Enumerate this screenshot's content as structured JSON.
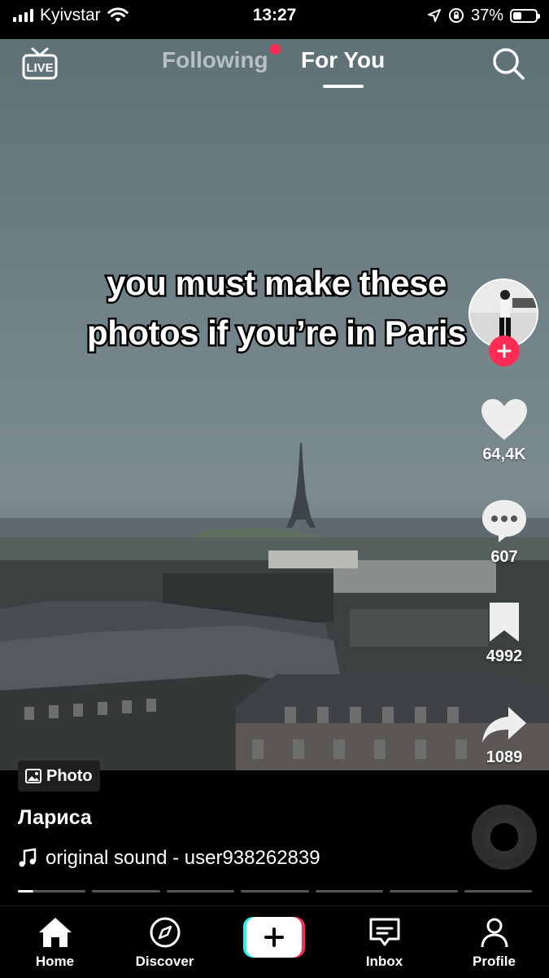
{
  "status_bar": {
    "carrier": "Kyivstar",
    "time": "13:27",
    "battery": "37%",
    "battery_level": 0.37
  },
  "top_nav": {
    "live_label": "LIVE",
    "following_label": "Following",
    "for_you_label": "For You"
  },
  "post": {
    "caption_line1": "you must make these",
    "caption_line2": "photos if you’re in Paris",
    "likes": "64,4K",
    "comments": "607",
    "saves": "4992",
    "shares": "1089",
    "badge_label": "Photo",
    "username": "Лариса",
    "sound": "original sound - user938262839",
    "slide_count": 7,
    "current_slide": 1
  },
  "bottom_nav": {
    "home": "Home",
    "discover": "Discover",
    "inbox": "Inbox",
    "profile": "Profile"
  },
  "colors": {
    "accent": "#fe2c55",
    "cyan": "#25f4ee"
  }
}
